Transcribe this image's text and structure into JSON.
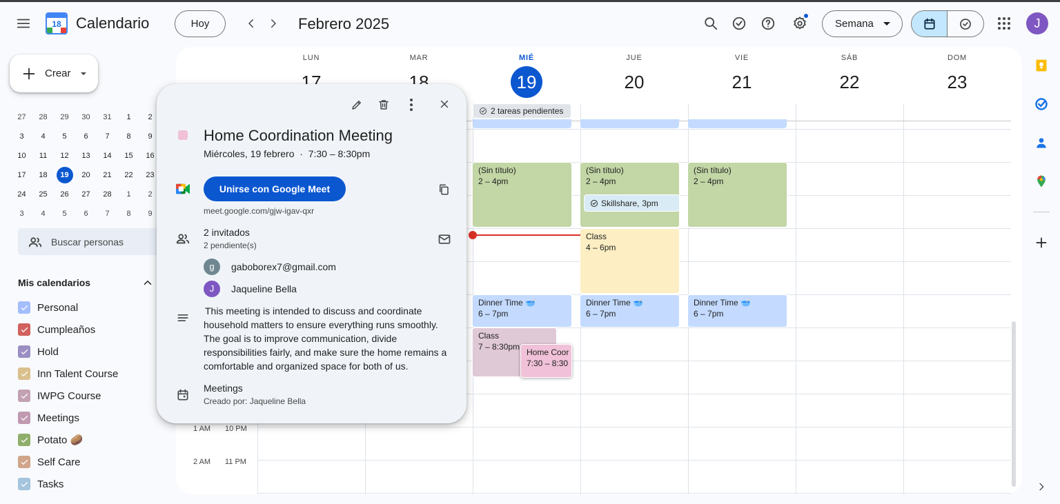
{
  "header": {
    "app_title": "Calendario",
    "logo_day": "18",
    "today_label": "Hoy",
    "current_period": "Febrero 2025",
    "view_selector": "Semana",
    "avatar_initial": "J"
  },
  "sidebar": {
    "create_label": "Crear",
    "search_people_placeholder": "Buscar personas",
    "mini_calendar": {
      "rows": [
        [
          "27",
          "28",
          "29",
          "30",
          "31",
          "1",
          "2"
        ],
        [
          "3",
          "4",
          "5",
          "6",
          "7",
          "8",
          "9"
        ],
        [
          "10",
          "11",
          "12",
          "13",
          "14",
          "15",
          "16"
        ],
        [
          "17",
          "18",
          "19",
          "20",
          "21",
          "22",
          "23"
        ],
        [
          "24",
          "25",
          "26",
          "27",
          "28",
          "1",
          "2"
        ],
        [
          "3",
          "4",
          "5",
          "6",
          "7",
          "8",
          "9"
        ]
      ],
      "today": "19"
    },
    "my_calendars_title": "Mis calendarios",
    "calendars": [
      {
        "label": "Personal",
        "color": "#a4bdfc"
      },
      {
        "label": "Cumpleaños",
        "color": "#d1625f"
      },
      {
        "label": "Hold",
        "color": "#9a8ec2"
      },
      {
        "label": "Inn Talent Course",
        "color": "#d9c08d"
      },
      {
        "label": "IWPG Course",
        "color": "#c3a1b5"
      },
      {
        "label": "Meetings",
        "color": "#c09ab0"
      },
      {
        "label": "Potato 🥔",
        "color": "#8fae6b"
      },
      {
        "label": "Self Care",
        "color": "#d0a58a"
      },
      {
        "label": "Tasks",
        "color": "#a5c4dd"
      }
    ]
  },
  "week": {
    "days": [
      {
        "dow": "LUN",
        "num": "17"
      },
      {
        "dow": "MAR",
        "num": "18"
      },
      {
        "dow": "MIÉ",
        "num": "19"
      },
      {
        "dow": "JUE",
        "num": "20"
      },
      {
        "dow": "VIE",
        "num": "21"
      },
      {
        "dow": "SÁB",
        "num": "22"
      },
      {
        "dow": "DOM",
        "num": "23"
      }
    ],
    "pending_tasks_chip": "2 tareas pendientes",
    "time_labels": [
      {
        "a": "1 AM",
        "b": "10 PM"
      },
      {
        "a": "2 AM",
        "b": "11 PM"
      }
    ],
    "events": {
      "untitled_title": "(Sin título)",
      "untitled_time": "2 – 4pm",
      "skillshare_title": "Skillshare",
      "skillshare_time": "3pm",
      "class_title": "Class",
      "class_thu_time": "4 – 6pm",
      "dinner_title": "Dinner Time 🥣",
      "dinner_time": "6 – 7pm",
      "class_wed_time": "7 – 8:30pm",
      "home_title": "Home Coor",
      "home_time": "7:30 – 8:30"
    }
  },
  "popup": {
    "title": "Home Coordination Meeting",
    "date_time": "Miércoles, 19 febrero  ·  7:30 – 8:30pm",
    "meet_button": "Unirse con Google Meet",
    "meet_link": "meet.google.com/gjw-igav-qxr",
    "guests_count": "2 invitados",
    "guests_pending": "2 pendiente(s)",
    "guests": [
      {
        "initial": "g",
        "name": "gaboborex7@gmail.com",
        "color": "#6f8790"
      },
      {
        "initial": "J",
        "name": "Jaqueline Bella",
        "color": "#7e57c2"
      }
    ],
    "description": "This meeting is intended to discuss and coordinate household matters to ensure everything runs smoothly. The goal is to improve communication, divide responsibilities fairly, and make sure the home remains a comfortable and organized space for both of us.",
    "calendar_name": "Meetings",
    "created_by": "Creado por: Jaqueline Bella",
    "event_color": "#f0c1d8"
  }
}
